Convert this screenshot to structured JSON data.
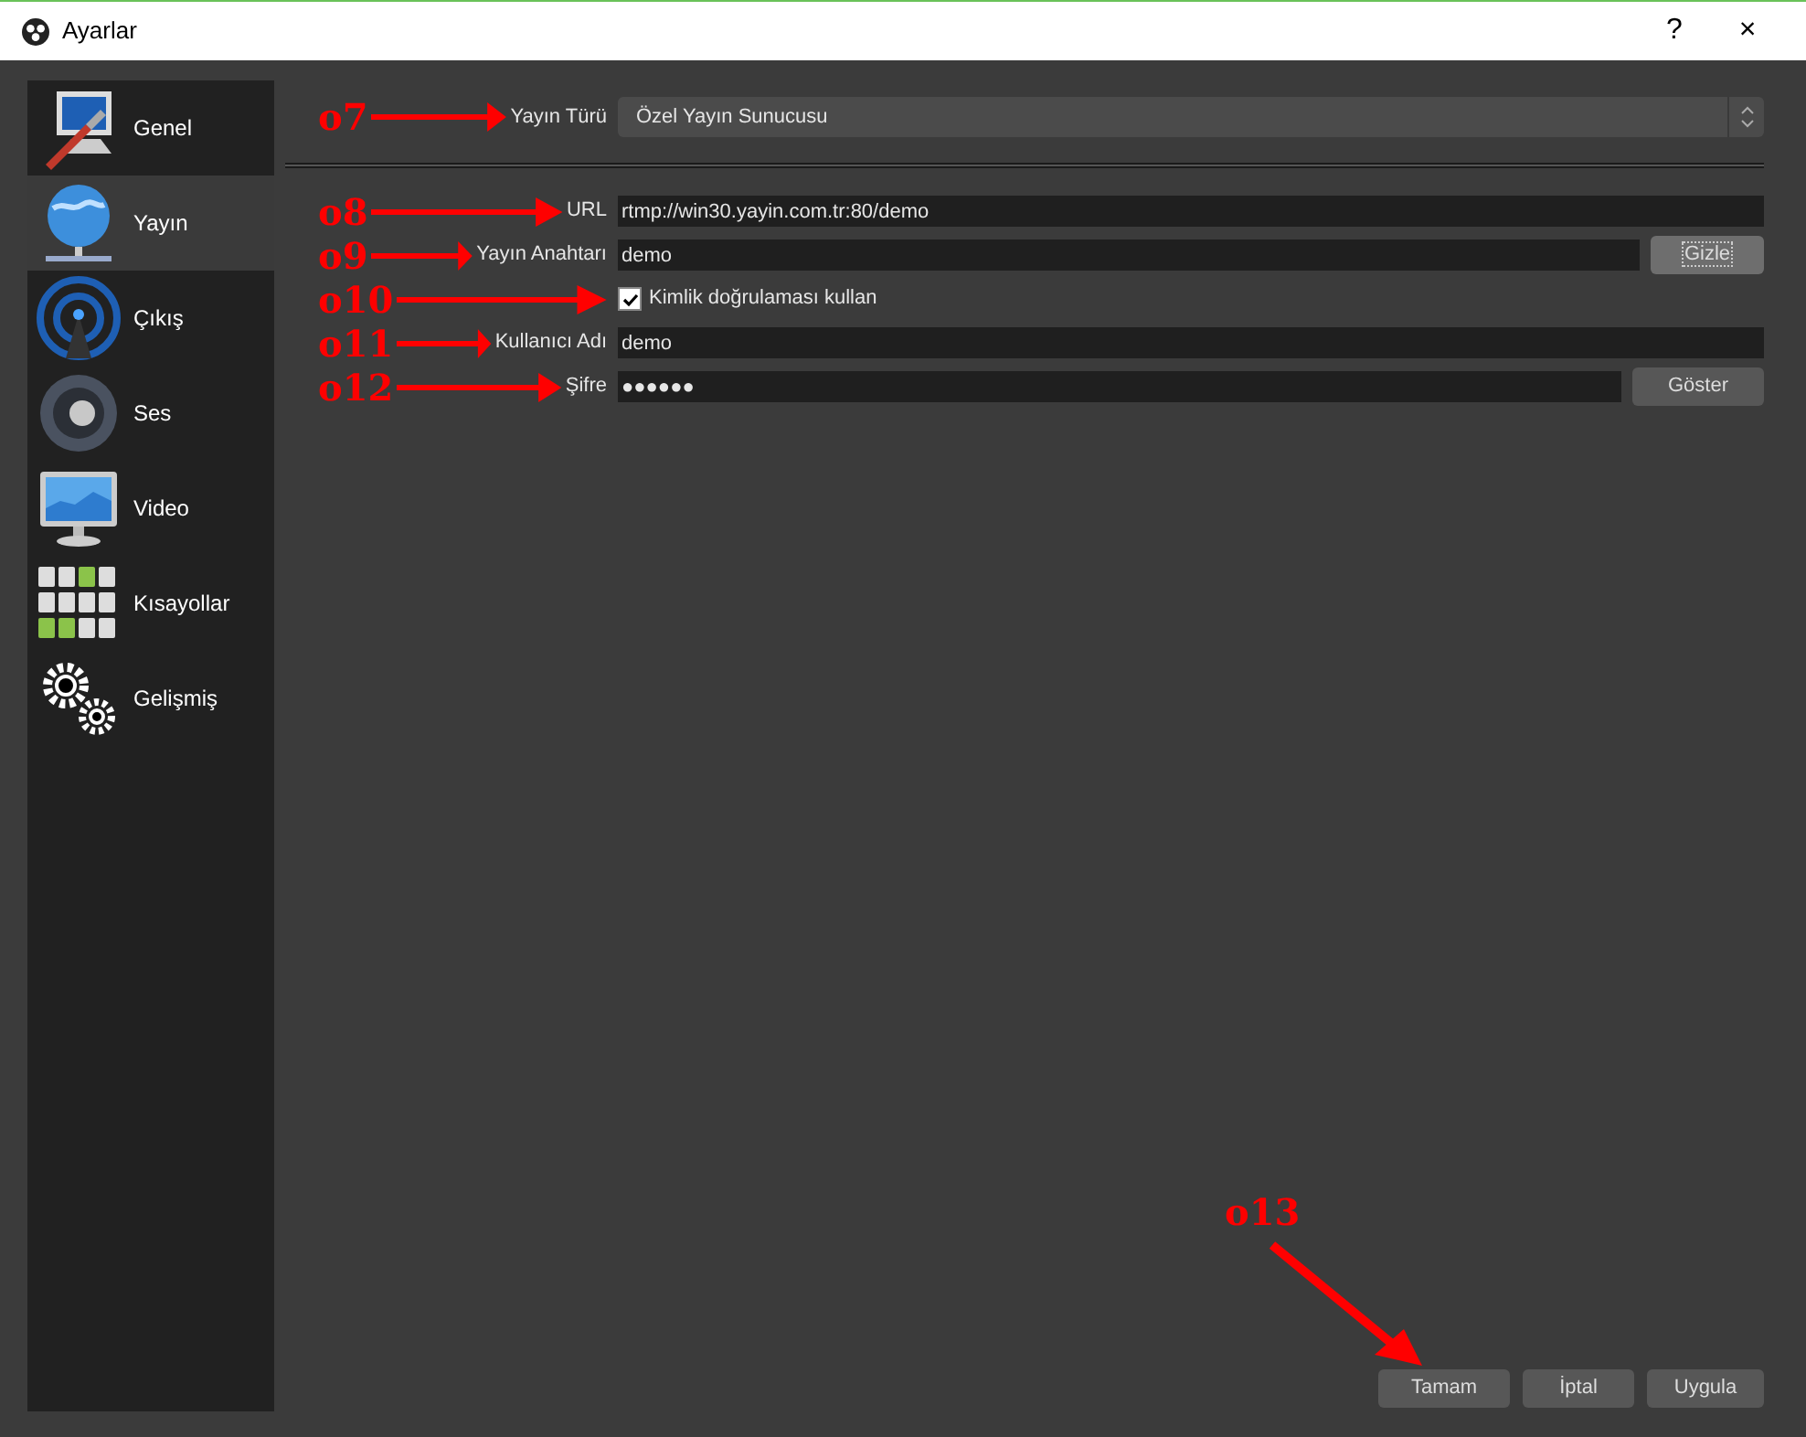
{
  "window": {
    "title": "Ayarlar",
    "controls": [
      "?",
      "×"
    ]
  },
  "sidebar": {
    "items": [
      {
        "label": "Genel",
        "kind": "general",
        "selected": false
      },
      {
        "label": "Yayın",
        "kind": "stream",
        "selected": true
      },
      {
        "label": "Çıkış",
        "kind": "output",
        "selected": false
      },
      {
        "label": "Ses",
        "kind": "audio",
        "selected": false
      },
      {
        "label": "Video",
        "kind": "video",
        "selected": false
      },
      {
        "label": "Kısayollar",
        "kind": "hotkeys",
        "selected": false
      },
      {
        "label": "Gelişmiş",
        "kind": "advanced",
        "selected": false
      }
    ]
  },
  "stream_type": {
    "annotation": "o7",
    "label": "Yayın Türü",
    "value": "Özel Yayın Sunucusu"
  },
  "fields": [
    {
      "kind": "text",
      "annotation": "o8",
      "label": "URL",
      "value": "rtmp://win30.yayin.com.tr:80/demo"
    },
    {
      "kind": "text",
      "annotation": "o9",
      "label": "Yayın Anahtarı",
      "value": "demo",
      "button": {
        "label": "Gizle",
        "focused": true
      }
    },
    {
      "kind": "checkbox",
      "annotation": "o10",
      "label": "Kimlik doğrulaması kullan",
      "checked": true
    },
    {
      "kind": "text",
      "annotation": "o11",
      "label": "Kullanıcı Adı",
      "value": "demo"
    },
    {
      "kind": "text",
      "annotation": "o12",
      "label": "Şifre",
      "value": "●●●●●●",
      "button": {
        "label": "Göster",
        "focused": false
      }
    }
  ],
  "footer": {
    "annotation": "o13",
    "buttons": [
      "Tamam",
      "İptal",
      "Uygula"
    ]
  }
}
